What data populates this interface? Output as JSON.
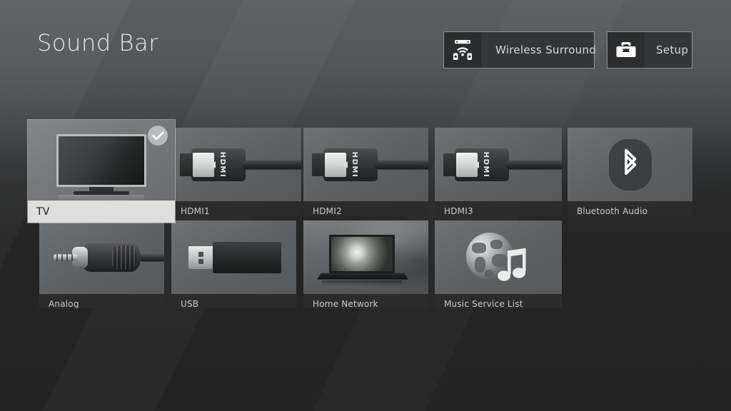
{
  "header": {
    "title": "Sound Bar",
    "buttons": [
      {
        "label": "Wireless Surround",
        "icon": "wireless-surround-icon"
      },
      {
        "label": "Setup",
        "icon": "toolbox-icon"
      }
    ]
  },
  "sources": {
    "selected": "TV",
    "row1": [
      {
        "label": "TV",
        "icon": "television-icon",
        "selected": true
      },
      {
        "label": "HDMI1",
        "icon": "hdmi-cable-icon",
        "selected": false
      },
      {
        "label": "HDMI2",
        "icon": "hdmi-cable-icon",
        "selected": false
      },
      {
        "label": "HDMI3",
        "icon": "hdmi-cable-icon",
        "selected": false
      },
      {
        "label": "Bluetooth Audio",
        "icon": "bluetooth-icon",
        "selected": false
      }
    ],
    "row2": [
      {
        "label": "Analog",
        "icon": "analog-jack-icon",
        "selected": false
      },
      {
        "label": "USB",
        "icon": "usb-drive-icon",
        "selected": false
      },
      {
        "label": "Home Network",
        "icon": "laptop-icon",
        "selected": false
      },
      {
        "label": "Music Service List",
        "icon": "globe-music-icon",
        "selected": false
      }
    ],
    "hdmi_connector_text": "HDMI",
    "check_badge": "check-icon"
  },
  "colors": {
    "background_top": "#5b5f62",
    "background_bottom": "#232323",
    "tile_label_bg": "#2b2b2b",
    "tile_label_text": "#c9cacb",
    "selected_label_bg": "#dededd",
    "selected_label_text": "#1b1b1b",
    "title_text": "#e8e9ea",
    "button_border": "#8d9195"
  }
}
